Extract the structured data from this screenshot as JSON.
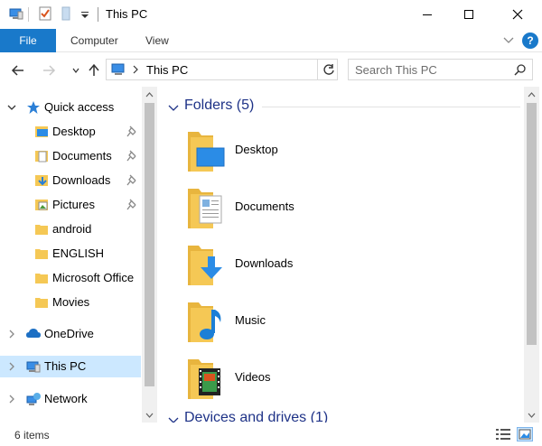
{
  "window": {
    "title": "This PC"
  },
  "ribbon": {
    "tabs": [
      {
        "label": "File"
      },
      {
        "label": "Computer"
      },
      {
        "label": "View"
      }
    ],
    "help_label": "?"
  },
  "address": {
    "path": "This PC",
    "search_placeholder": "Search This PC"
  },
  "nav": {
    "items": [
      {
        "label": "Quick access"
      },
      {
        "label": "Desktop"
      },
      {
        "label": "Documents"
      },
      {
        "label": "Downloads"
      },
      {
        "label": "Pictures"
      },
      {
        "label": "android"
      },
      {
        "label": "ENGLISH"
      },
      {
        "label": "Microsoft Office"
      },
      {
        "label": "Movies"
      },
      {
        "label": "OneDrive"
      },
      {
        "label": "This PC"
      },
      {
        "label": "Network"
      }
    ]
  },
  "content": {
    "folders_group": "Folders (5)",
    "folders": [
      {
        "label": "Desktop"
      },
      {
        "label": "Documents"
      },
      {
        "label": "Downloads"
      },
      {
        "label": "Music"
      },
      {
        "label": "Videos"
      }
    ],
    "devices_group": "Devices and drives (1)"
  },
  "status": {
    "item_count": "6 items"
  },
  "colors": {
    "accent": "#1979ca",
    "selection": "#cce8ff",
    "group_title": "#1e3287",
    "folder": "#f5c855"
  }
}
